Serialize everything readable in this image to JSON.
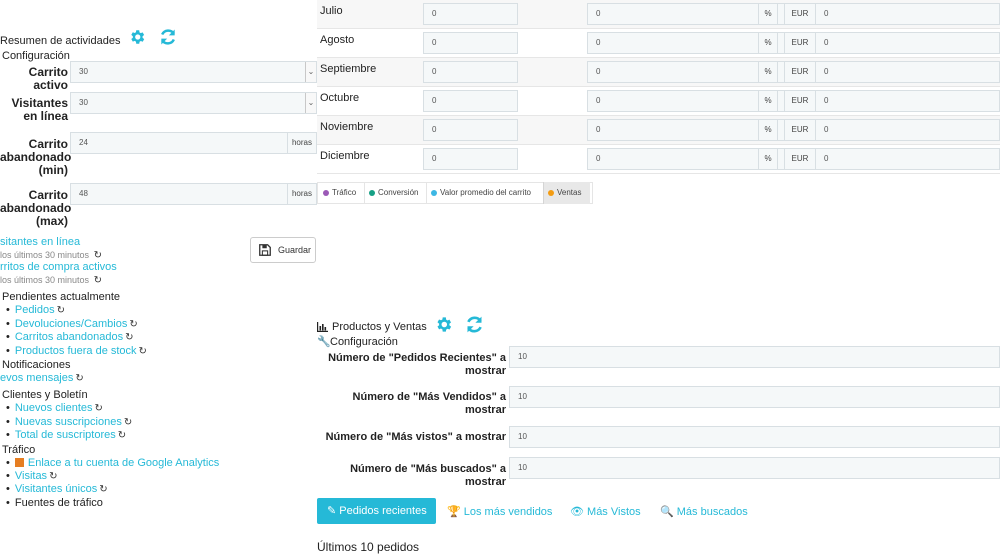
{
  "left": {
    "header": {
      "title": "Resumen de actividades",
      "config_label": "Configuración"
    },
    "fields": [
      {
        "label": "Carrito activo",
        "value": "30",
        "kind": "select"
      },
      {
        "label": "Visitantes en línea",
        "value": "30",
        "kind": "select"
      },
      {
        "label": "Carrito abandonado (min)",
        "value": "24",
        "unit": "horas",
        "kind": "text"
      },
      {
        "label": "Carrito abandonado (max)",
        "value": "48",
        "unit": "horas",
        "kind": "text"
      }
    ],
    "save_label": "Guardar",
    "online_visitors": {
      "title": "sitantes en línea",
      "sub": "los últimos 30 minutos"
    },
    "active_carts": {
      "title": "rritos de compra activos",
      "sub": "los últimos 30 minutos"
    },
    "pending": {
      "title": "Pendientes actualmente",
      "items": [
        "Pedidos",
        "Devoluciones/Cambios",
        "Carritos abandonados",
        "Productos fuera de stock"
      ]
    },
    "notifications": {
      "title": "Notificaciones",
      "item": "evos mensajes"
    },
    "customers": {
      "title": "Clientes y Boletín",
      "items": [
        "Nuevos clientes",
        "Nuevas suscripciones",
        "Total de suscriptores"
      ]
    },
    "traffic": {
      "title": "Tráfico",
      "analytics": "Enlace a tu cuenta de Google Analytics",
      "visits": "Visitas",
      "unique": "Visitantes únicos",
      "sources": "Fuentes de tráfico"
    }
  },
  "months_table": {
    "currency": "EUR",
    "percent": "%",
    "rows": [
      {
        "month": "Julio",
        "v1": "0",
        "v2": "0",
        "v3": "0"
      },
      {
        "month": "Agosto",
        "v1": "0",
        "v2": "0",
        "v3": "0"
      },
      {
        "month": "Septiembre",
        "v1": "0",
        "v2": "0",
        "v3": "0"
      },
      {
        "month": "Octubre",
        "v1": "0",
        "v2": "0",
        "v3": "0"
      },
      {
        "month": "Noviembre",
        "v1": "0",
        "v2": "0",
        "v3": "0"
      },
      {
        "month": "Diciembre",
        "v1": "0",
        "v2": "0",
        "v3": "0"
      }
    ]
  },
  "legend": [
    {
      "label": "Tráfico",
      "color": "#9b59b6"
    },
    {
      "label": "Conversión",
      "color": "#16a085"
    },
    {
      "label": "Valor promedio del carrito",
      "color": "#3db7e4"
    },
    {
      "label": "Ventas",
      "color": "#f39c12",
      "active": true
    }
  ],
  "products": {
    "title": "Productos y Ventas",
    "config_label": "Configuración",
    "fields": [
      {
        "label": "Número de \"Pedidos Recientes\" a mostrar",
        "value": "10"
      },
      {
        "label": "Número de \"Más Vendidos\" a mostrar",
        "value": "10"
      },
      {
        "label": "Número de \"Más vistos\" a mostrar",
        "value": "10"
      },
      {
        "label": "Número de \"Más buscados\" a mostrar",
        "value": "10"
      }
    ],
    "tabs": [
      "Pedidos recientes",
      "Los más vendidos",
      "Más Vistos",
      "Más buscados"
    ],
    "section_heading": "Últimos 10 pedidos"
  },
  "colors": {
    "accent": "#25b9d7",
    "gear": "#25b9d7",
    "tab_active_bg": "#25b9d7"
  }
}
